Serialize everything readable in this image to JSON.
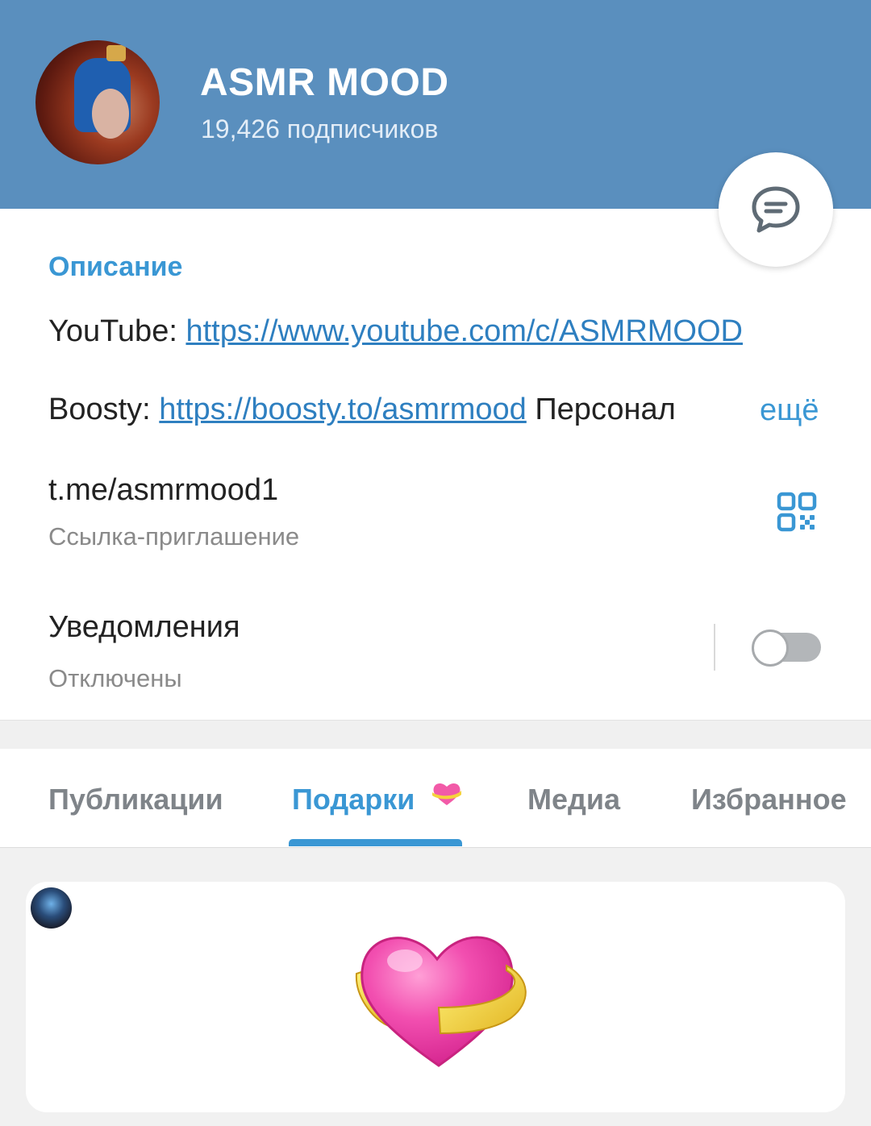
{
  "header": {
    "title": "ASMR MOOD",
    "subscribers": "19,426 подписчиков"
  },
  "description": {
    "section_title": "Описание",
    "youtube_label": "YouTube:",
    "youtube_url": "https://www.youtube.com/c/ASMRMOOD",
    "boosty_label": "Boosty:",
    "boosty_url": "https://boosty.to/asmrmood",
    "boosty_tail": "Персонал",
    "more_label": "ещё"
  },
  "invite": {
    "link": "t.me/asmrmood1",
    "label": "Ссылка-приглашение"
  },
  "notifications": {
    "title": "Уведомления",
    "status": "Отключены",
    "enabled": false
  },
  "tabs": [
    {
      "label": "Публикации",
      "active": false
    },
    {
      "label": "Подарки",
      "active": true
    },
    {
      "label": "Медиа",
      "active": false
    },
    {
      "label": "Избранное",
      "active": false
    }
  ],
  "colors": {
    "header_bg": "#5a8fbe",
    "accent": "#3a97d4",
    "link": "#2e7fc0"
  },
  "icons": {
    "chat": "chat-bubble-icon",
    "qr": "qr-code-icon",
    "tab_emoji": "heart-ribbon-icon",
    "gift": "heart-ribbon-gift-icon"
  }
}
